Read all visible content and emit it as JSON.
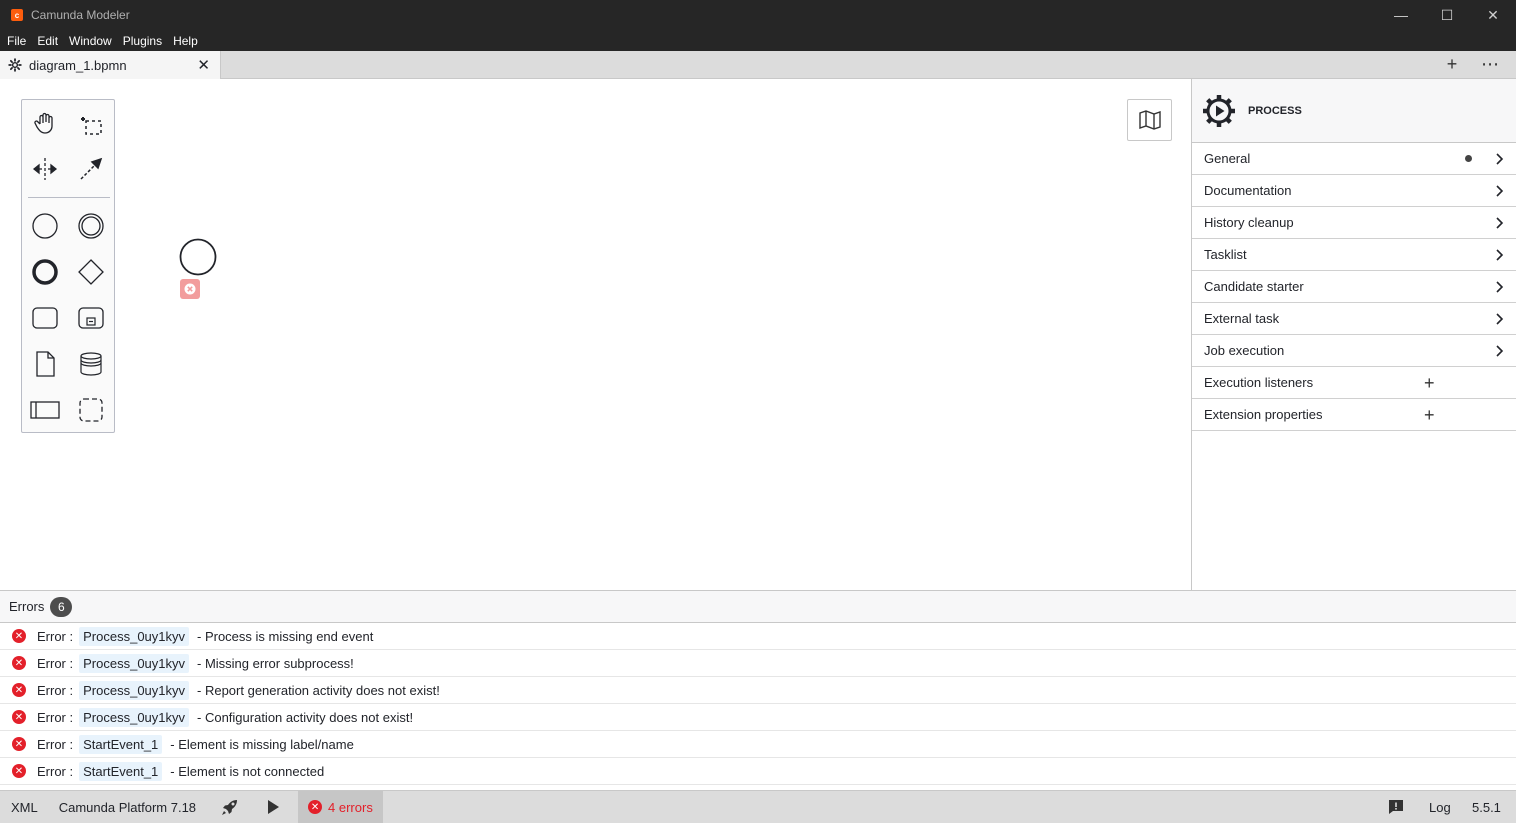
{
  "window": {
    "title": "Camunda Modeler",
    "minimize": "—",
    "maximize": "☐",
    "close": "✕"
  },
  "menu": [
    "File",
    "Edit",
    "Window",
    "Plugins",
    "Help"
  ],
  "tab": {
    "label": "diagram_1.bpmn",
    "close": "✕",
    "add": "+",
    "more": "⋯"
  },
  "properties": {
    "element_type": "PROCESS",
    "groups": [
      {
        "label": "General",
        "kind": "chevron",
        "has_dot": true
      },
      {
        "label": "Documentation",
        "kind": "chevron"
      },
      {
        "label": "History cleanup",
        "kind": "chevron"
      },
      {
        "label": "Tasklist",
        "kind": "chevron"
      },
      {
        "label": "Candidate starter",
        "kind": "chevron"
      },
      {
        "label": "External task",
        "kind": "chevron"
      },
      {
        "label": "Job execution",
        "kind": "chevron"
      },
      {
        "label": "Execution listeners",
        "kind": "plus",
        "plus": "+"
      },
      {
        "label": "Extension properties",
        "kind": "plus",
        "plus": "+"
      }
    ]
  },
  "errors_panel": {
    "tab_label": "Errors",
    "count": "6",
    "rows": [
      {
        "label": "Error :",
        "id": "Process_0uy1kyv",
        "message": "- Process is missing end event"
      },
      {
        "label": "Error :",
        "id": "Process_0uy1kyv",
        "message": "- Missing error subprocess!"
      },
      {
        "label": "Error :",
        "id": "Process_0uy1kyv",
        "message": "- Report generation activity does not exist!"
      },
      {
        "label": "Error :",
        "id": "Process_0uy1kyv",
        "message": "- Configuration activity does not exist!"
      },
      {
        "label": "Error :",
        "id": "StartEvent_1",
        "message": "- Element is missing label/name"
      },
      {
        "label": "Error :",
        "id": "StartEvent_1",
        "message": "- Element is not connected"
      }
    ]
  },
  "statusbar": {
    "xml": "XML",
    "platform": "Camunda Platform 7.18",
    "errors": "4 errors",
    "log": "Log",
    "version": "5.5.1"
  },
  "colors": {
    "titlebar": "#262626",
    "error_red": "#e3202a",
    "id_highlight": "#e8f3fc",
    "brand_orange": "#fc5d0d"
  },
  "icons": {
    "app_logo": "camunda-logo-icon",
    "tab_settings": "gear-icon",
    "props_header": "process-gear-icon",
    "minimap": "map-icon",
    "deploy": "rocket-icon",
    "run": "play-icon",
    "feedback": "feedback-icon"
  }
}
